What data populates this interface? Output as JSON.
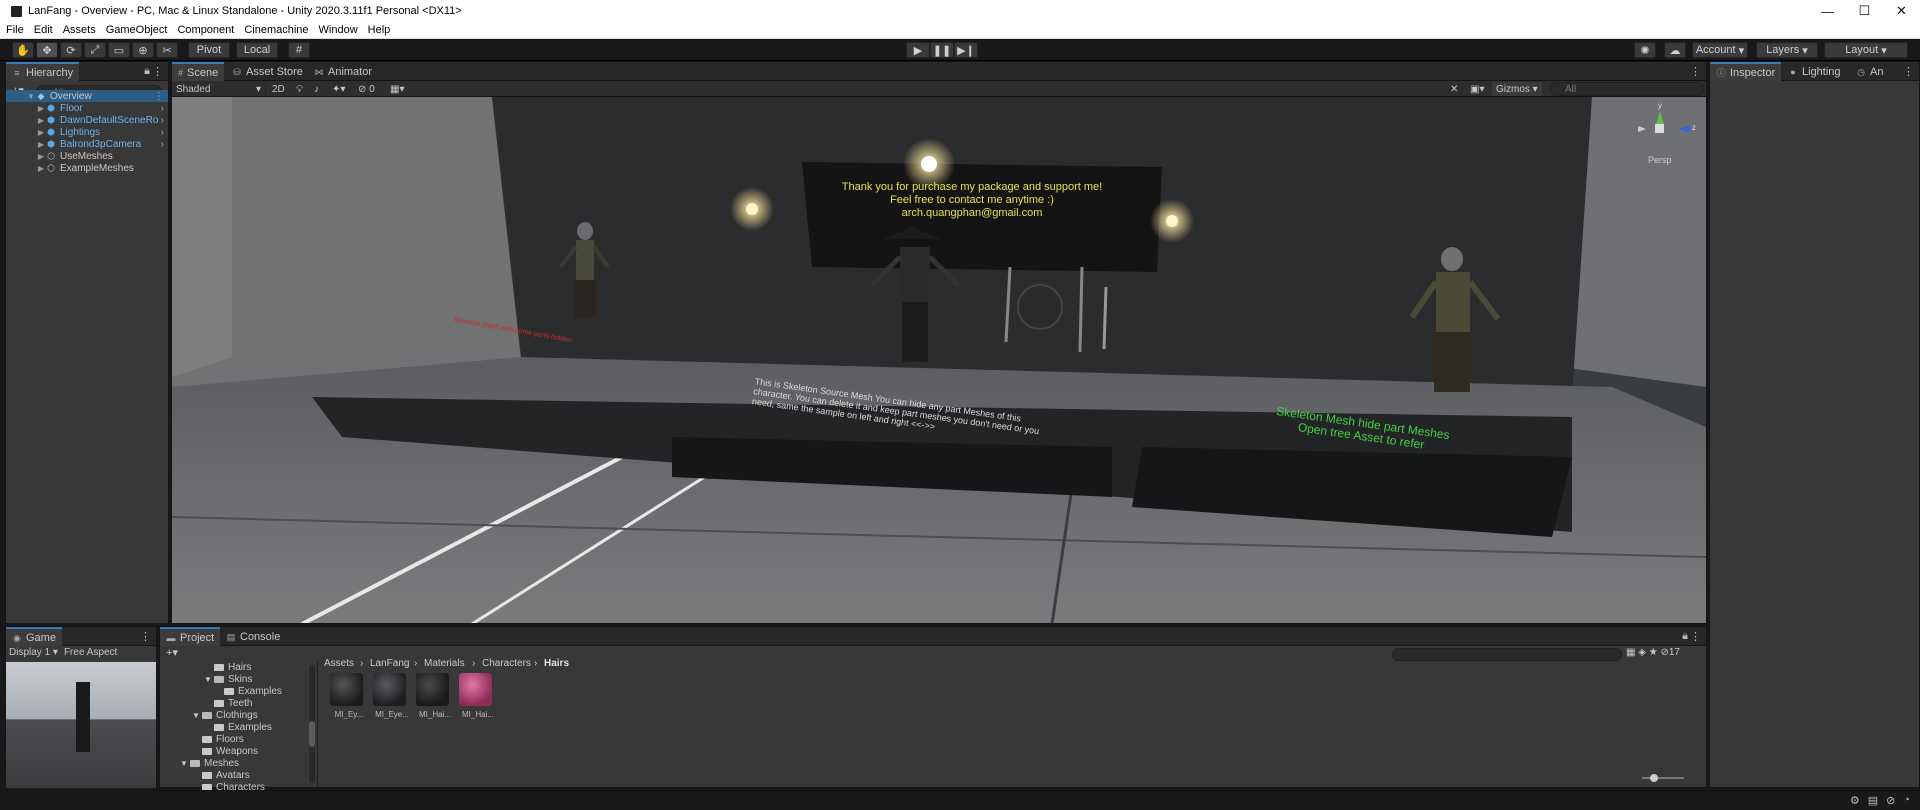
{
  "window": {
    "title": "LanFang - Overview - PC, Mac & Linux Standalone - Unity 2020.3.11f1 Personal <DX11>",
    "minimize": "—",
    "maximize": "☐",
    "close": "✕"
  },
  "menu": [
    "File",
    "Edit",
    "Assets",
    "GameObject",
    "Component",
    "Cinemachine",
    "Window",
    "Help"
  ],
  "toolbar": {
    "pivot_label": "Pivot",
    "local_label": "Local",
    "account_label": "Account",
    "layers_label": "Layers",
    "layout_label": "Layout"
  },
  "hierarchy": {
    "tab_label": "Hierarchy",
    "add_label": "+▾",
    "search_placeholder": "All",
    "items": [
      {
        "label": "Overview",
        "indent": 0,
        "blue": false,
        "selected": true,
        "expanded": true
      },
      {
        "label": "Floor",
        "indent": 1,
        "blue": true
      },
      {
        "label": "DawnDefaultSceneRo",
        "indent": 1,
        "blue": true
      },
      {
        "label": "Lightings",
        "indent": 1,
        "blue": true
      },
      {
        "label": "Balrond3pCamera",
        "indent": 1,
        "blue": true
      },
      {
        "label": "UseMeshes",
        "indent": 1,
        "blue": false
      },
      {
        "label": "ExampleMeshes",
        "indent": 1,
        "blue": false
      }
    ]
  },
  "scene": {
    "tabs": [
      "Scene",
      "Asset Store",
      "Animator"
    ],
    "shading": "Shaded",
    "mode_2d": "2D",
    "gizmos_label": "Gizmos",
    "search_placeholder": "All",
    "hidden_count": "0",
    "persp_label": "Persp",
    "axis_y": "y",
    "axis_z": "z",
    "sign_line1": "Thank you for purchase my package and support me!",
    "sign_line2": "Feel free to contact me anytime :)",
    "sign_line3": "arch.quangphan@gmail.com",
    "center_note": "This is Skeleton Source Mesh You can hide any part Meshes of this character. You can delete it and keep part meshes you don't need or you need, same the sample on left and right <<->>",
    "right_note_1": "Skeleton Mesh hide part Meshes",
    "right_note_2": "Open tree Asset to refer",
    "left_note": "Skeleton mesh with some parts hidden"
  },
  "inspector": {
    "tabs": [
      "Inspector",
      "Lighting",
      "An"
    ]
  },
  "game": {
    "tab_label": "Game",
    "display_label": "Display 1",
    "aspect_label": "Free Aspect"
  },
  "project": {
    "tabs": [
      "Project",
      "Console"
    ],
    "add_label": "+▾",
    "tree": [
      {
        "label": "Hairs",
        "indent": 2,
        "open": false
      },
      {
        "label": "Skins",
        "indent": 2,
        "open": true
      },
      {
        "label": "Examples",
        "indent": 3,
        "open": false
      },
      {
        "label": "Teeth",
        "indent": 2,
        "open": false
      },
      {
        "label": "Clothings",
        "indent": 1,
        "open": true
      },
      {
        "label": "Examples",
        "indent": 2,
        "open": false
      },
      {
        "label": "Floors",
        "indent": 1,
        "open": false
      },
      {
        "label": "Weapons",
        "indent": 1,
        "open": false
      },
      {
        "label": "Meshes",
        "indent": 0,
        "open": true
      },
      {
        "label": "Avatars",
        "indent": 1,
        "open": false
      },
      {
        "label": "Characters",
        "indent": 1,
        "open": false
      }
    ],
    "breadcrumb": [
      "Assets",
      "LanFang",
      "Materials",
      "Characters",
      "Hairs"
    ],
    "assets": [
      {
        "label": "MI_Ey...",
        "color": "#2b2b2b"
      },
      {
        "label": "MI_Eye...",
        "color": "#303036"
      },
      {
        "label": "MI_Hai...",
        "color": "#2a2a2a"
      },
      {
        "label": "MI_Hai...",
        "color": "#b8487a"
      }
    ],
    "hidden_count": "17"
  }
}
